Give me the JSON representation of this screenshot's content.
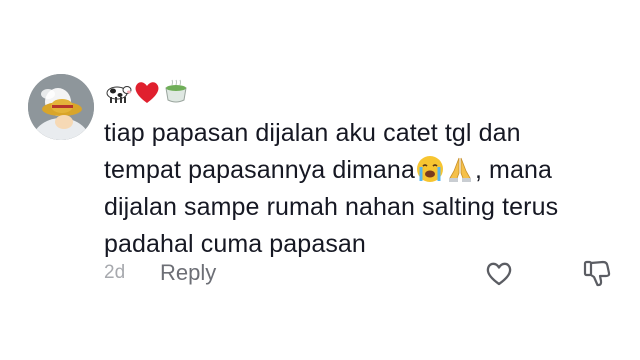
{
  "comment": {
    "avatar_icon": "avatar-straw-hat-figure",
    "username_emojis": [
      "cow-icon",
      "red-heart-icon",
      "teacup-icon"
    ],
    "text_line1": "tiap papasan dijalan aku catet tgl dan",
    "text_line2_part1": "tempat papasannya dimana",
    "text_line2_part2": ", mana",
    "text_line3": "dijalan sampe rumah nahan salting terus",
    "text_line4": "padahal cuma papasan",
    "inline_emojis": [
      "loudly-crying-face-icon",
      "folded-hands-icon"
    ],
    "timestamp": "2d",
    "reply_label": "Reply",
    "like_icon": "heart-outline-icon",
    "dislike_icon": "thumbs-down-outline-icon"
  },
  "colors": {
    "text": "#161823",
    "muted": "#a7a9ae",
    "reply": "#6d6f76",
    "icon": "#5b5d63"
  }
}
